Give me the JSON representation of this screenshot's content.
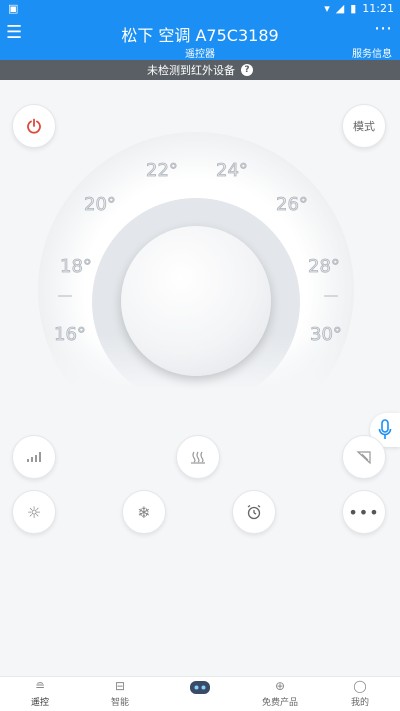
{
  "status_bar": {
    "left_icon": "app-notification-icon",
    "time": "11:21"
  },
  "header": {
    "title": "松下 空调 A75C3189",
    "subtitle": "遥控器",
    "service_label": "服务信息"
  },
  "ir_notice": {
    "text": "未检测到红外设备",
    "help": "?"
  },
  "controls": {
    "mode_label": "模式"
  },
  "dial": {
    "temps": [
      "22°",
      "24°",
      "20°",
      "26°",
      "18°",
      "28°",
      "16°",
      "30°"
    ]
  },
  "colors": {
    "primary": "#1b8ff3",
    "power_red": "#e0463a",
    "banner": "#5a5f66"
  },
  "tabbar": {
    "tabs": [
      {
        "label": "遥控",
        "icon": "remote-icon",
        "active": true
      },
      {
        "label": "智能",
        "icon": "smart-icon",
        "active": false
      },
      {
        "label": "",
        "icon": "robot-icon",
        "active": false
      },
      {
        "label": "免费产品",
        "icon": "plus-circle-icon",
        "active": false
      },
      {
        "label": "我的",
        "icon": "user-icon",
        "active": false
      }
    ]
  }
}
